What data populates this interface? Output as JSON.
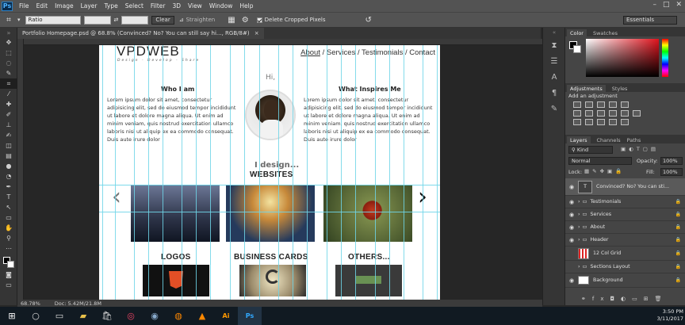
{
  "menubar": {
    "logo": "Ps",
    "items": [
      "File",
      "Edit",
      "Image",
      "Layer",
      "Type",
      "Select",
      "Filter",
      "3D",
      "View",
      "Window",
      "Help"
    ]
  },
  "options": {
    "ratio": "Ratio",
    "clear": "Clear",
    "straighten": "Straighten",
    "delete_cropped": "Delete Cropped Pixels",
    "workspace": "Essentials"
  },
  "document": {
    "tab_title": "Portfolio Homepage.psd @ 68.8% (Convinced? No? You can still say hi..., RGB/8#)",
    "zoom": "68.78%",
    "doc_size": "Doc: 5.42M/21.8M"
  },
  "page": {
    "logo": "VPDWEB",
    "tagline": "Design - Develop - Share",
    "nav_about": "About",
    "nav_rest": " / Services / Testimonials / Contact",
    "hi": "Hi,",
    "col1_title": "Who I am",
    "col2_title": "What Inspires Me",
    "lorem": "Lorem ipsum dolor sit amet, consectetur adipisicing elit, sed do eiusmod tempor incididunt ut labore et dolore magna aliqua. Ut enim ad minim veniam, quis nostrud exercitation ullamco laboris nisi ut aliquip ex ea commodo consequat. Duis aute irure dolor",
    "i_design": "I design...",
    "websites": "WEBSITES",
    "logos": "LOGOS",
    "business_cards": "BUSINESS CARDS",
    "others": "OTHERS...",
    "prev": "‹",
    "next": "›"
  },
  "panels": {
    "color_tab": "Color",
    "swatches_tab": "Swatches",
    "adjustments_tab": "Adjustments",
    "styles_tab": "Styles",
    "add_adjustment": "Add an adjustment",
    "layers_tab": "Layers",
    "channels_tab": "Channels",
    "paths_tab": "Paths",
    "kind": "Kind",
    "blend": "Normal",
    "opacity_label": "Opacity:",
    "opacity": "100%",
    "lock_label": "Lock:",
    "fill_label": "Fill:",
    "fill": "100%",
    "layers": [
      "Convinced? No? You can sti...",
      "Testimonials",
      "Services",
      "About",
      "Header",
      "12 Col Grid",
      "Sections Layout",
      "Background"
    ]
  },
  "taskbar": {
    "time": "3:50 PM",
    "date": "3/11/2017"
  },
  "colors": {
    "accent": "#31a8ff",
    "guide": "#6fd5e8"
  }
}
